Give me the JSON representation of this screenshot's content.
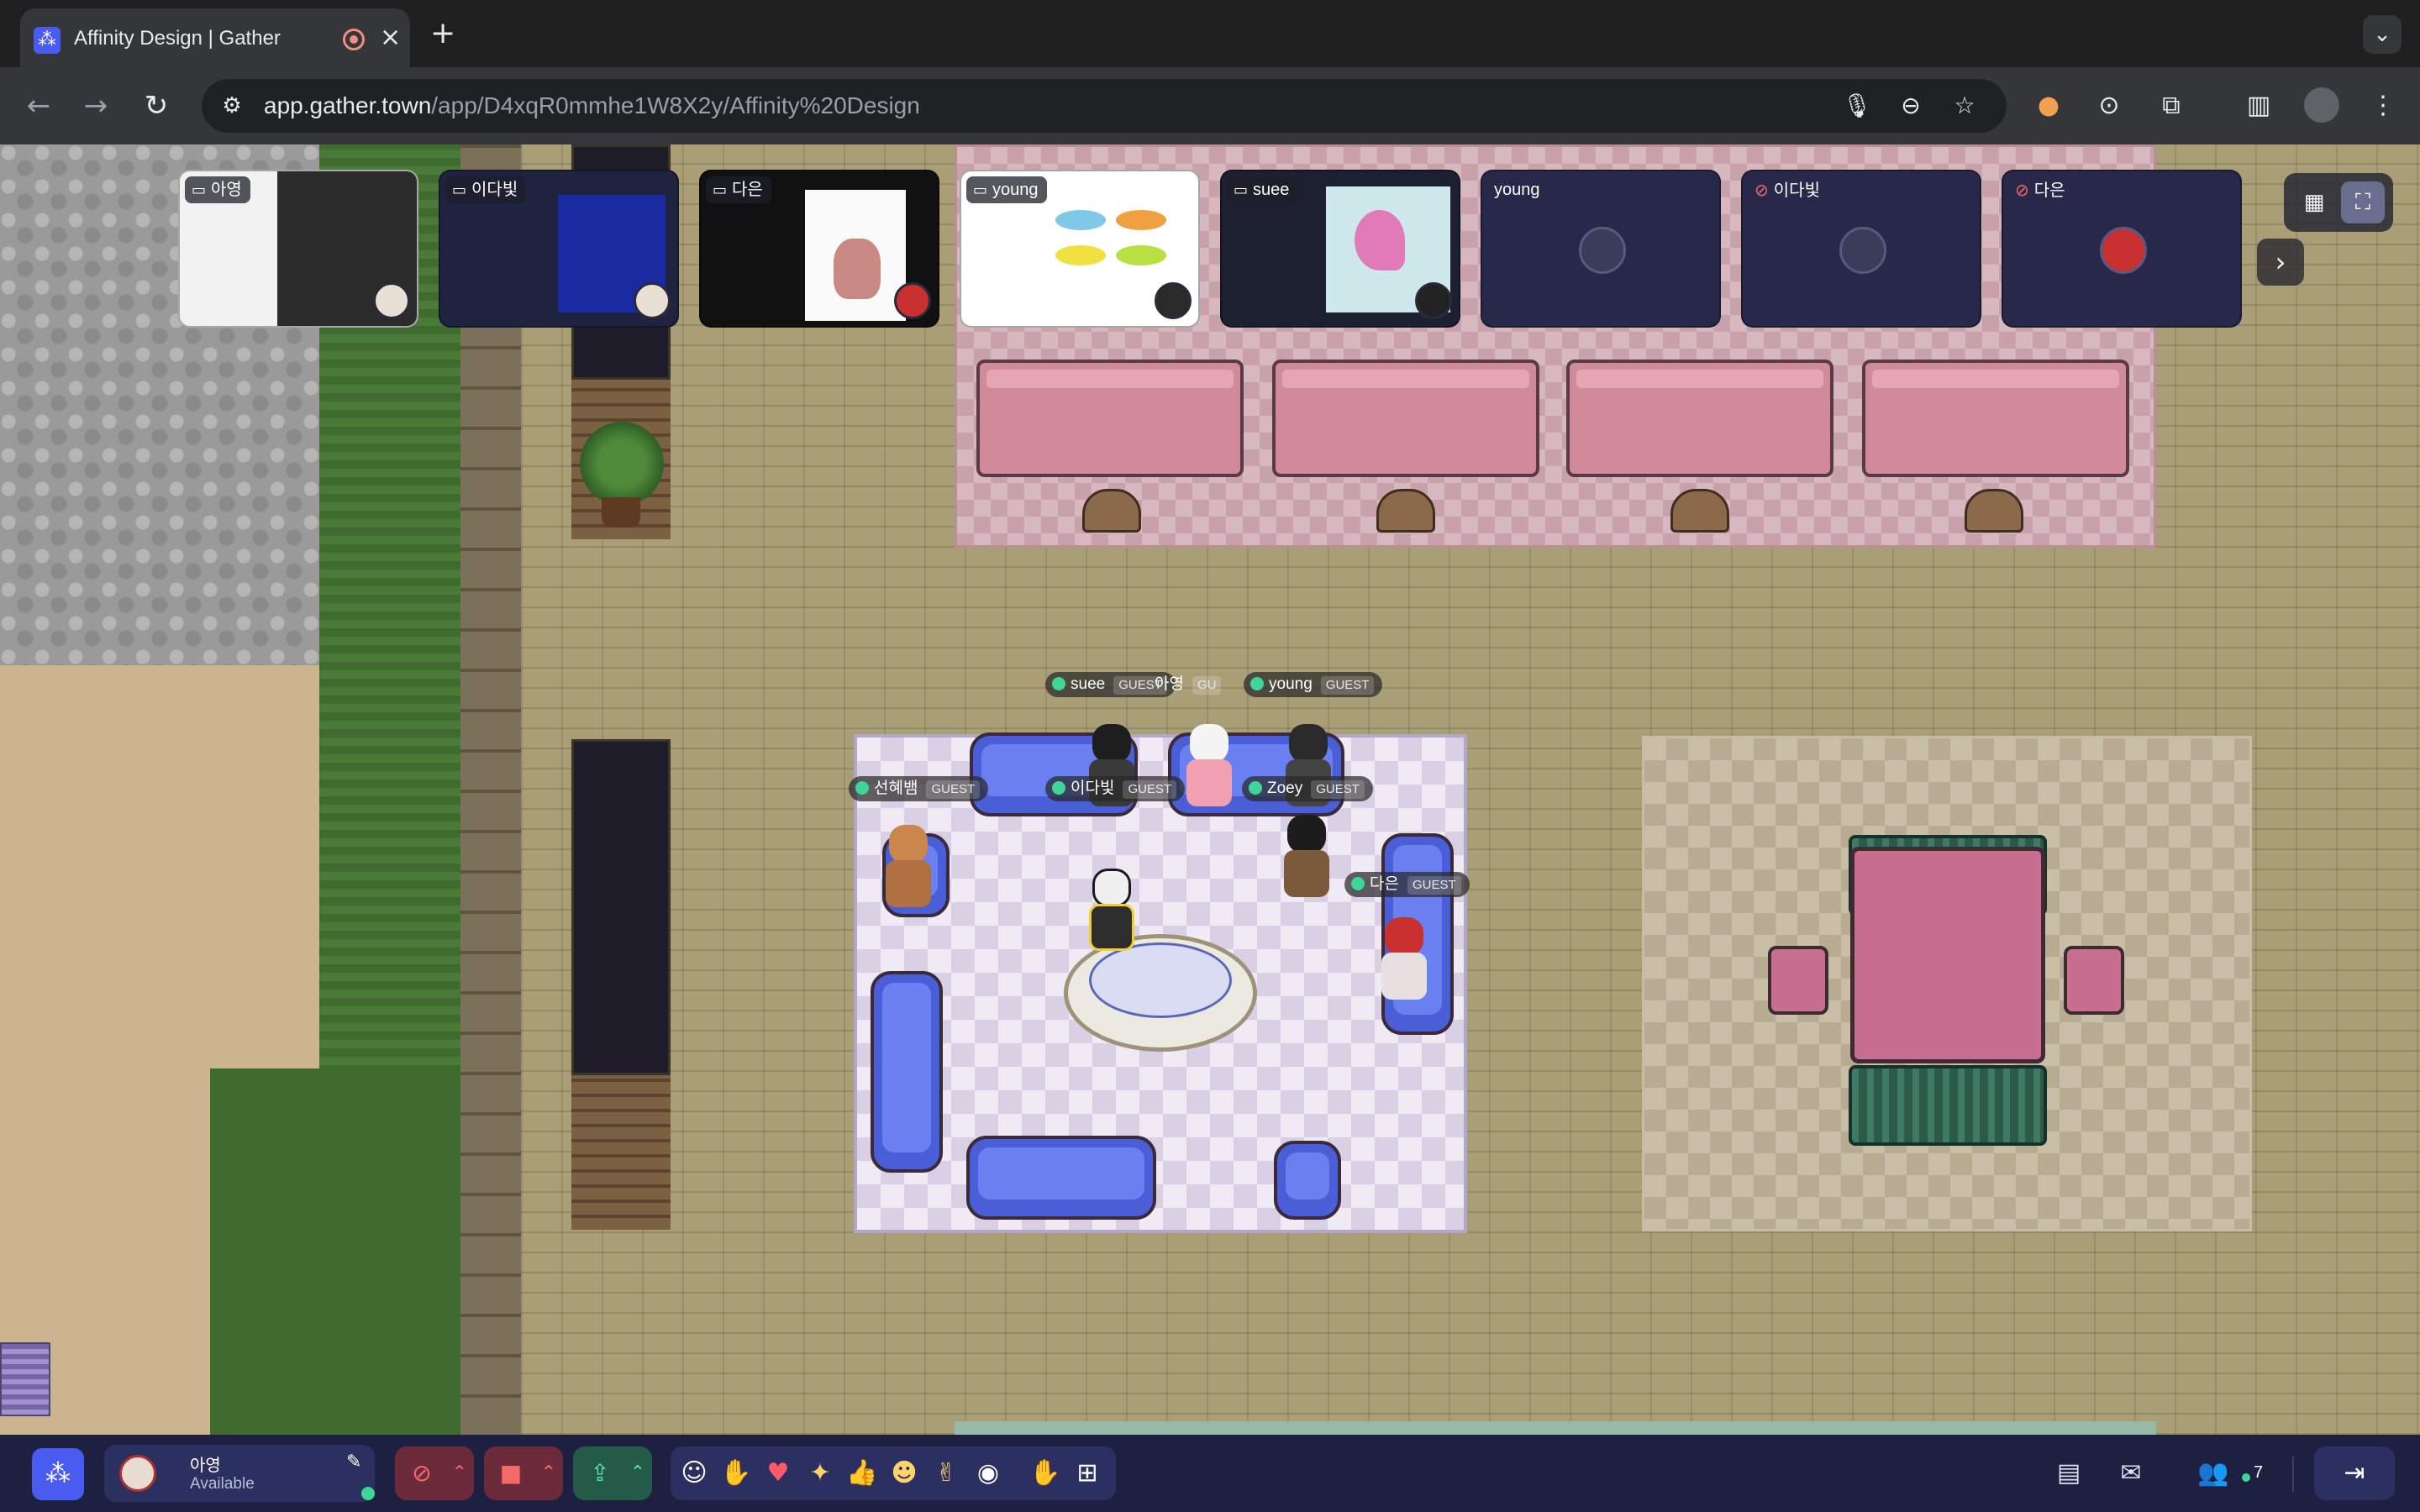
{
  "browser": {
    "tab_title": "Affinity Design | Gather",
    "favicon": "gather-icon",
    "url_host": "app.gather.town",
    "url_path": "/app/D4xqR0mmhe1W8X2y/Affinity%20Design"
  },
  "tiles": [
    {
      "label": "아영",
      "type": "screen"
    },
    {
      "label": "이다빛",
      "type": "screen"
    },
    {
      "label": "다은",
      "type": "screen"
    },
    {
      "label": "young",
      "type": "screen"
    },
    {
      "label": "suee",
      "type": "screen"
    },
    {
      "label": "young",
      "type": "camera"
    },
    {
      "label": "이다빛",
      "type": "camera",
      "muted": true
    },
    {
      "label": "다은",
      "type": "camera",
      "muted": true
    }
  ],
  "players": {
    "sueee": "suee",
    "ayoung": "아영",
    "young": "young",
    "seonhye": "선혜뱀",
    "idabit": "이다빛",
    "zoey": "Zoey",
    "daeun": "다은",
    "guest_badge": "GUEST",
    "guest_badge_cut": "GU"
  },
  "bottom": {
    "user_name": "아영",
    "user_status": "Available",
    "participant_count": "7"
  },
  "colors": {
    "accent": "#4a5cf0",
    "online": "#3ed598",
    "muted": "#f26a6a",
    "bottombar": "#1d2040"
  }
}
